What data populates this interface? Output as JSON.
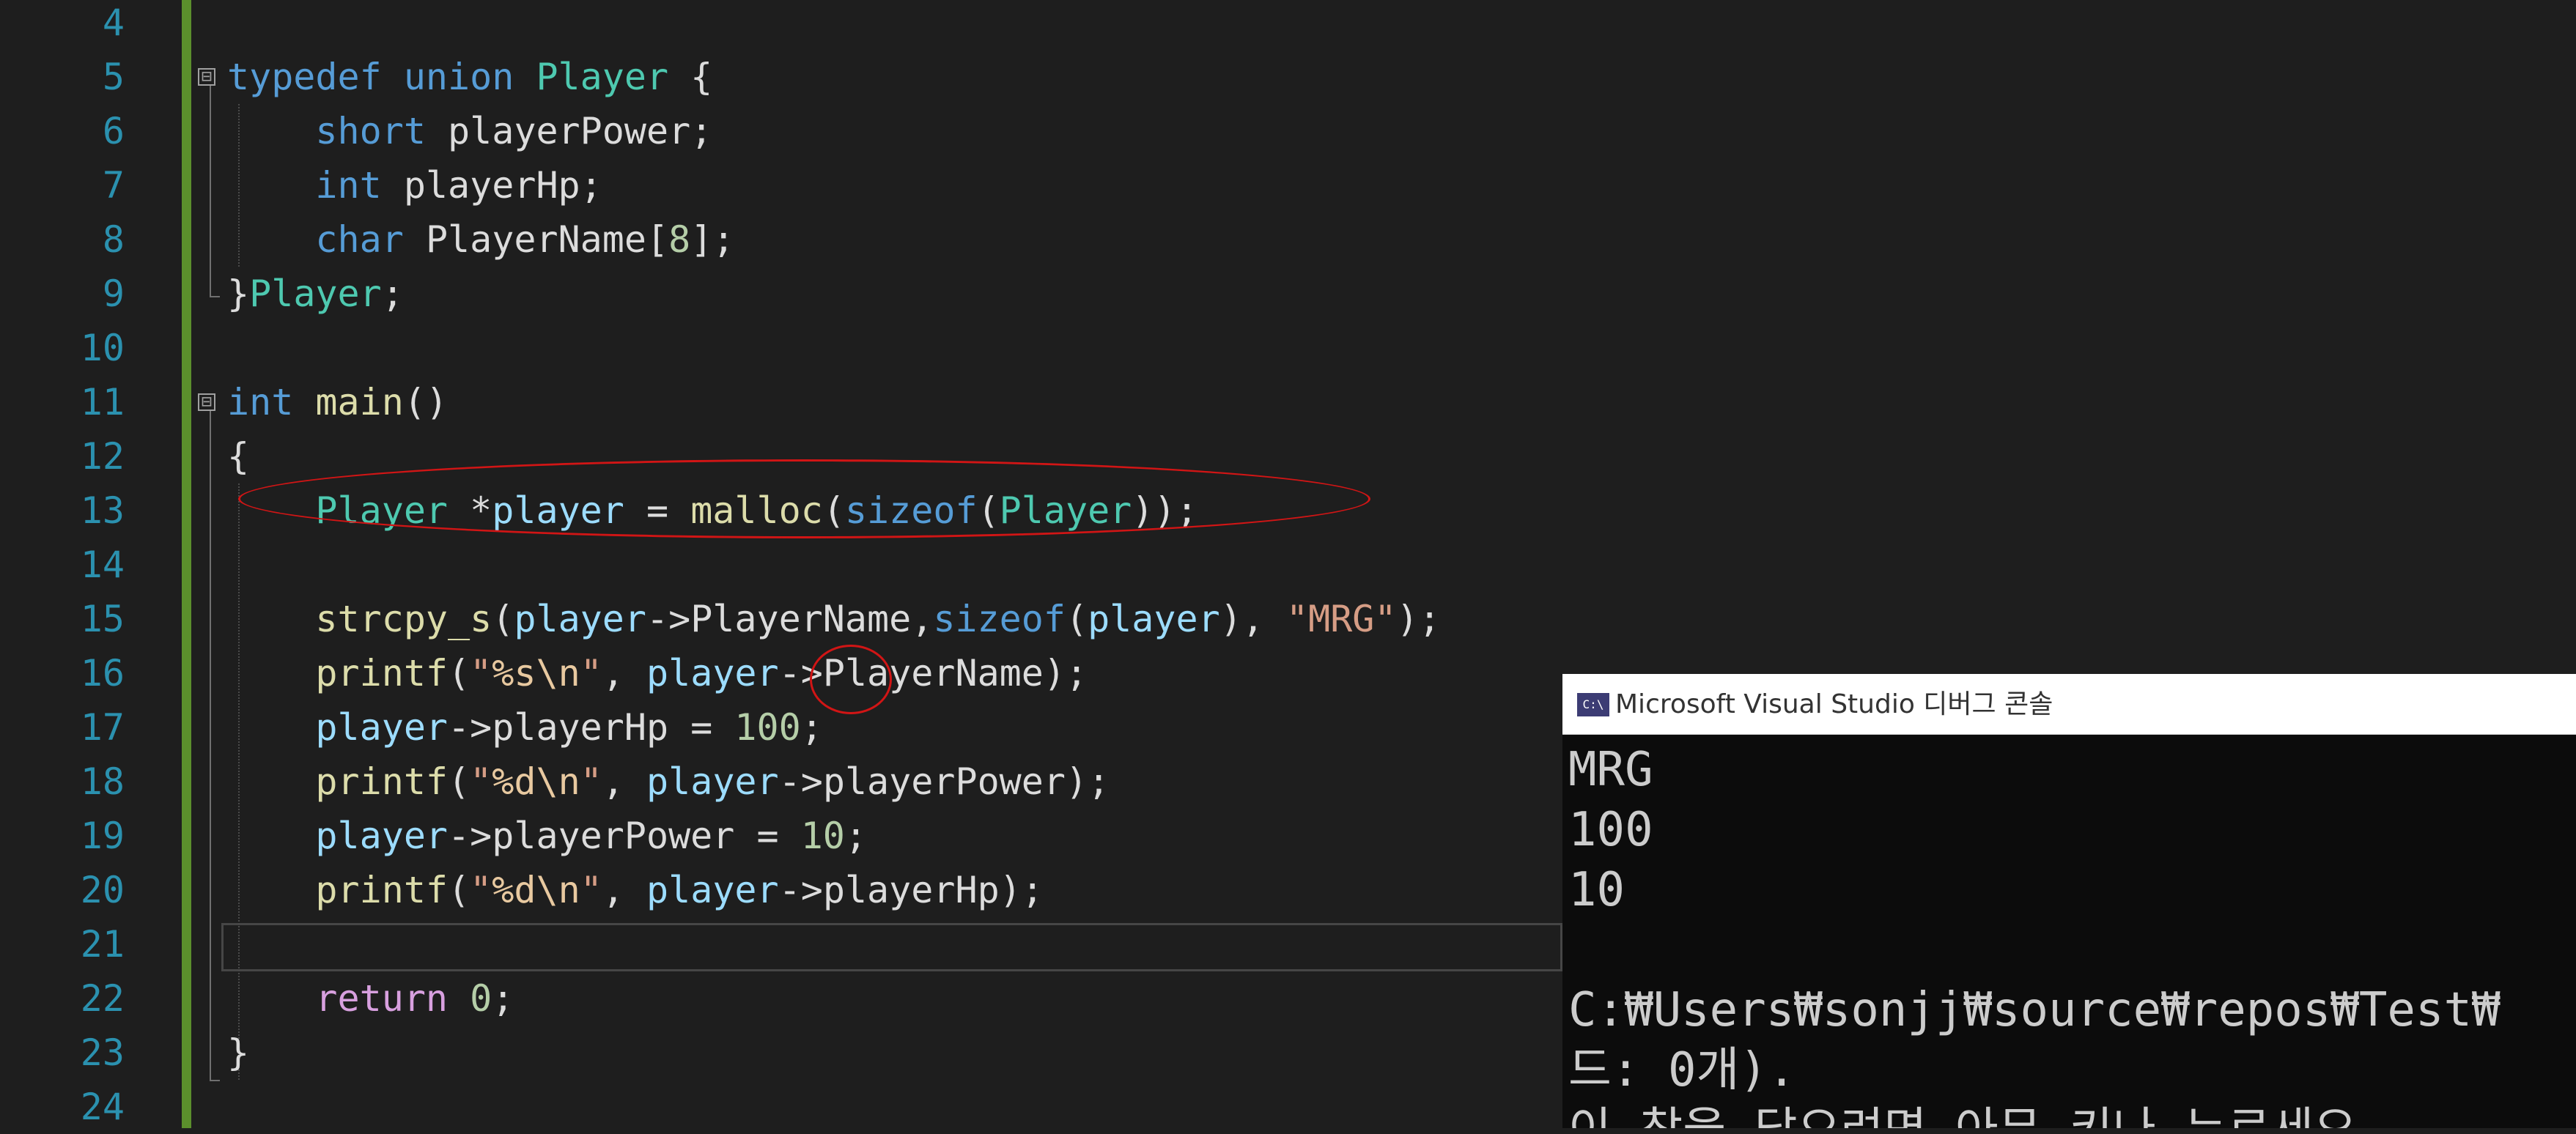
{
  "editor": {
    "line_numbers": [
      "4",
      "5",
      "6",
      "7",
      "8",
      "9",
      "10",
      "11",
      "12",
      "13",
      "14",
      "15",
      "16",
      "17",
      "18",
      "19",
      "20",
      "21",
      "22",
      "23",
      "24"
    ],
    "lines": [
      [],
      [
        [
          "kw",
          "typedef"
        ],
        [
          "plain",
          " "
        ],
        [
          "kw",
          "union"
        ],
        [
          "plain",
          " "
        ],
        [
          "ty",
          "Player"
        ],
        [
          "plain",
          " {"
        ]
      ],
      [
        [
          "plain",
          "    "
        ],
        [
          "kw",
          "short"
        ],
        [
          "plain",
          " playerPower;"
        ]
      ],
      [
        [
          "plain",
          "    "
        ],
        [
          "kw",
          "int"
        ],
        [
          "plain",
          " playerHp;"
        ]
      ],
      [
        [
          "plain",
          "    "
        ],
        [
          "kw",
          "char"
        ],
        [
          "plain",
          " PlayerName["
        ],
        [
          "num",
          "8"
        ],
        [
          "plain",
          "];"
        ]
      ],
      [
        [
          "plain",
          "}"
        ],
        [
          "ty",
          "Player"
        ],
        [
          "plain",
          ";"
        ]
      ],
      [],
      [
        [
          "kw",
          "int"
        ],
        [
          "plain",
          " "
        ],
        [
          "fn",
          "main"
        ],
        [
          "plain",
          "()"
        ]
      ],
      [
        [
          "plain",
          "{"
        ]
      ],
      [
        [
          "plain",
          "    "
        ],
        [
          "ty",
          "Player"
        ],
        [
          "plain",
          " *"
        ],
        [
          "var",
          "player"
        ],
        [
          "plain",
          " = "
        ],
        [
          "fn",
          "malloc"
        ],
        [
          "plain",
          "("
        ],
        [
          "kw",
          "sizeof"
        ],
        [
          "plain",
          "("
        ],
        [
          "ty",
          "Player"
        ],
        [
          "plain",
          "));"
        ]
      ],
      [],
      [
        [
          "plain",
          "    "
        ],
        [
          "fn",
          "strcpy_s"
        ],
        [
          "plain",
          "("
        ],
        [
          "var",
          "player"
        ],
        [
          "plain",
          "->PlayerName,"
        ],
        [
          "kw",
          "sizeof"
        ],
        [
          "plain",
          "("
        ],
        [
          "var",
          "player"
        ],
        [
          "plain",
          "), "
        ],
        [
          "str",
          "\"MRG\""
        ],
        [
          "plain",
          ");"
        ]
      ],
      [
        [
          "plain",
          "    "
        ],
        [
          "fn",
          "printf"
        ],
        [
          "plain",
          "("
        ],
        [
          "str",
          "\""
        ],
        [
          "esc",
          "%s\\n"
        ],
        [
          "str",
          "\""
        ],
        [
          "plain",
          ", "
        ],
        [
          "var",
          "player"
        ],
        [
          "plain",
          "->PlayerName);"
        ]
      ],
      [
        [
          "plain",
          "    "
        ],
        [
          "var",
          "player"
        ],
        [
          "plain",
          "->playerHp = "
        ],
        [
          "num",
          "100"
        ],
        [
          "plain",
          ";"
        ]
      ],
      [
        [
          "plain",
          "    "
        ],
        [
          "fn",
          "printf"
        ],
        [
          "plain",
          "("
        ],
        [
          "str",
          "\""
        ],
        [
          "esc",
          "%d\\n"
        ],
        [
          "str",
          "\""
        ],
        [
          "plain",
          ", "
        ],
        [
          "var",
          "player"
        ],
        [
          "plain",
          "->playerPower);"
        ]
      ],
      [
        [
          "plain",
          "    "
        ],
        [
          "var",
          "player"
        ],
        [
          "plain",
          "->playerPower = "
        ],
        [
          "num",
          "10"
        ],
        [
          "plain",
          ";"
        ]
      ],
      [
        [
          "plain",
          "    "
        ],
        [
          "fn",
          "printf"
        ],
        [
          "plain",
          "("
        ],
        [
          "str",
          "\""
        ],
        [
          "esc",
          "%d\\n"
        ],
        [
          "str",
          "\""
        ],
        [
          "plain",
          ", "
        ],
        [
          "var",
          "player"
        ],
        [
          "plain",
          "->playerHp);"
        ]
      ],
      [],
      [
        [
          "plain",
          "    "
        ],
        [
          "ctl",
          "return"
        ],
        [
          "plain",
          " "
        ],
        [
          "num",
          "0"
        ],
        [
          "plain",
          ";"
        ]
      ],
      [
        [
          "plain",
          "}"
        ]
      ],
      []
    ],
    "fold_symbol": "⊟"
  },
  "colors": {
    "background": "#1e1e1e",
    "line_number": "#2b91af",
    "change_bar": "#5b8f2c",
    "keyword": "#569cd6",
    "type": "#4ec9b0",
    "function": "#dcdcaa",
    "variable": "#9cdcfe",
    "number": "#b5cea8",
    "string": "#d69d85",
    "control": "#d8a0df",
    "annotation": "#d11515"
  },
  "console": {
    "icon_text": "C:\\",
    "title": "Microsoft Visual Studio 디버그 콘솔",
    "output_lines": [
      "MRG",
      "100",
      "10",
      "",
      "C:₩Users₩sonjj₩source₩repos₩Test₩",
      "드: 0개).",
      "이 창을 닫으려면 아무 키나 누르세요"
    ]
  }
}
